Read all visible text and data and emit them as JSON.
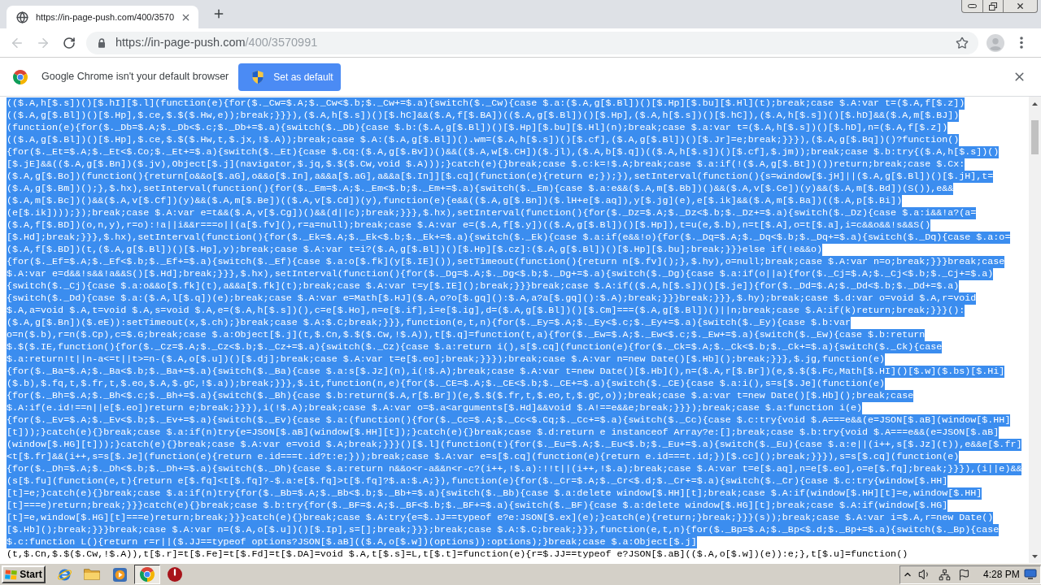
{
  "tabs": [
    {
      "title": "https://in-page-push.com/400/3570",
      "selected": true
    }
  ],
  "toolbar": {
    "back": {
      "disabled": true
    },
    "forward": {
      "disabled": true
    },
    "url": {
      "origin": "https://in-page-push.com",
      "path": "/400/3570991"
    }
  },
  "infobar": {
    "message": "Google Chrome isn't your default browser",
    "button": "Set as default"
  },
  "document": {
    "lines": [
      {
        "text": "(($.A,h[$.s])()[$.hI][$.l](function(e){for($._Cw=$.A;$._Cw<$.b;$._Cw+=$.a){switch($._Cw){case $.a:($.A,g[$.Bl])()[$.Hp][$.bu][$.Hl](t);break;case $.A:var t=($.A,f[$.z])",
        "selected": true
      },
      {
        "text": "(($.A,g[$.Bl])()[$.Hp],$.ce,$.$($.Hw,e));break;}}}),($.A,h[$.s])()[$.hC]&&($.A,f[$.BA])(($.A,g[$.Bl])()[$.Hp],($.A,h[$.s])()[$.hC]),($.A,h[$.s])()[$.hD]&&($.A,m[$.BJ])",
        "selected": true
      },
      {
        "text": "(function(e){for($._Db=$.A;$._Db<$.c;$._Db+=$.a){switch($._Db){case $.b:($.A,g[$.Bl])()[$.Hp][$.bu][$.Hl](n);break;case $.a:var t=($.A,h[$.s])()[$.hD],n=($.A,f[$.z])",
        "selected": true
      },
      {
        "text": "(($.A,g[$.Bl])()[$.Hp],$.ce,$.$($.Hw,t,$.jx,!$.A));break;case $.A:($.A,g[$.Bl])().wm=($.A,h[$.s])()[$.cf],($.A,g[$.Bl])()[$.Jr]=e;break;}}}),($.A,g[$.Bq])()?function()",
        "selected": true
      },
      {
        "text": "{for($._Et=$.A;$._Et<$.Co;$._Et+=$.a){switch($._Et){case $.Cq:($.A,g[$.Bv])()&&(($.A,w[$.CH])($.jl),($.A,b[$.q])(($.A,h[$.s])()[$.cf],$.jm));break;case $.b:try{($.A,h[$.s])()",
        "selected": true
      },
      {
        "text": "[$.jE]&&(($.A,g[$.Bn])($.jv),Object[$.j](navigator,$.jq,$.$($.Cw,void $.A)));}catch(e){}break;case $.c:k=!$.A;break;case $.a:if(!($.A,g[$.Bt])())return;break;case $.Cx:",
        "selected": true
      },
      {
        "text": "($.A,g[$.Bo])(function(){return[o&&o[$.aG],o&&o[$.In],a&&a[$.aG],a&&a[$.In]][$.cq](function(e){return e;});}),setInterval(function(){s=window[$.jH]||($.A,g[$.Bl])()[$.jH],t=",
        "selected": true
      },
      {
        "text": "($.A,g[$.Bm])();},$.hx),setInterval(function(){for($._Em=$.A;$._Em<$.b;$._Em+=$.a){switch($._Em){case $.a:e&&($.A,m[$.Bb])()&&($.A,v[$.Ce])(y)&&($.A,m[$.Bd])(S()),e&&",
        "selected": true
      },
      {
        "text": "($.A,m[$.Bc])()&&($.A,v[$.Cf])(y)&&($.A,m[$.Be])(($.A,v[$.Cd])(y),function(e){e&&(($.A,g[$.Bn])($.lH+e[$.aq]),y[$.jg](e),e[$.ik]&&($.A,m[$.Ba])(($.A,p[$.Bi])",
        "selected": true
      },
      {
        "text": "(e[$.ik])));});break;case $.A:var e=t&&($.A,v[$.Cg])()&&(d||c);break;}}},$.hx),setInterval(function(){for($._Dz=$.A;$._Dz<$.b;$._Dz+=$.a){switch($._Dz){case $.a:i&&!a?(a=",
        "selected": true
      },
      {
        "text": "($.A,f[$.BD])(o,n,y),r=o):!a||i&&r===o||(a[$.fv](),r=a=null);break;case $.A:var e=($.A,f[$.y])(($.A,g[$.Bl])()[$.Hp]),t=u(e,$.b),n=t[$.A],o=t[$.a],i=c&&o&&!s&&S()",
        "selected": true
      },
      {
        "text": "[$.Hd];break;}}},$.hx),setInterval(function(){for($._Ek=$.A;$._Ek<$.b;$._Ek+=$.a){switch($._Ek){case $.a:if(e&&!o){for($._Dq=$.A;$._Dq<$.b;$._Dq+=$.a){switch($._Dq){case $.a:o=",
        "selected": true
      },
      {
        "text": "($.A,f[$.BD])(t,($.A,g[$.Bl])()[$.Hp],y);break;case $.A:var t=i?($.A,g[$.Bl])()[$.Hp][$.cz]:($.A,g[$.Bl])()[$.Hp][$.bu];break;}}}else if(!e&&o)",
        "selected": true
      },
      {
        "text": "{for($._Ef=$.A;$._Ef<$.b;$._Ef+=$.a){switch($._Ef){case $.a:o[$.fk](y[$.IE]()),setTimeout(function(){return n[$.fv]();},$.hy),o=null;break;case $.A:var n=o;break;}}}break;case",
        "selected": true
      },
      {
        "text": "$.A:var e=d&&!s&&!a&&S()[$.Hd];break;}}},$.hx),setInterval(function(){for($._Dg=$.A;$._Dg<$.b;$._Dg+=$.a){switch($._Dg){case $.a:if(o||a){for($._Cj=$.A;$._Cj<$.b;$._Cj+=$.a)",
        "selected": true
      },
      {
        "text": "{switch($._Cj){case $.a:o&&o[$.fk](t),a&&a[$.fk](t);break;case $.A:var t=y[$.IE]();break;}}}break;case $.A:if(($.A,h[$.s])()[$.je]){for($._Dd=$.A;$._Dd<$.b;$._Dd+=$.a)",
        "selected": true
      },
      {
        "text": "{switch($._Dd){case $.a:($.A,l[$.q])(e);break;case $.A:var e=Math[$.HJ]($.A,o?o[$.gq]():$.A,a?a[$.gq]():$.A);break;}}}break;}}},$.hy);break;case $.d:var o=void $.A,r=void",
        "selected": true
      },
      {
        "text": "$.A,a=void $.A,t=void $.A,s=void $.A,e=($.A,h[$.s])(),c=e[$.Ho],n=e[$.if],i=e[$.ig],d=($.A,g[$.Bl])()[$.Cm]===($.A,g[$.Bl])()||n;break;case $.A:if(k)return;break;}}}():",
        "selected": true
      },
      {
        "text": "($.A,g[$.Bn])($.eE)):setTimeout(x,$.ch);}break;case $.A:$.C;break;}}},function(e,t,n){for($._Ey=$.A;$._Ey<$.c;$._Ey+=$.a){switch($._Ey){case $.b:var",
        "selected": true
      },
      {
        "text": "o=n($.b),r=n($.Cp),c=$.G;break;case $.a:Object[$.j](t,$.Cn,$.$($.Cw,!$.A)),t[$.q]=function(t,a){for($._Ew=$.A;$._Ew<$.c;$._Ew+=$.a){switch($._Ew){case $.b:return",
        "selected": true
      },
      {
        "text": "$.$($.IE,function(){for($._Cz=$.A;$._Cz<$.b;$._Cz+=$.a){switch($._Cz){case $.a:return i(),s[$.cq](function(e){for($._Ck=$.A;$._Ck<$.b;$._Ck+=$.a){switch($._Ck){case",
        "selected": true
      },
      {
        "text": "$.a:return!t||n-a<=t||t>=n-($.A,o[$.u])()[$.dj];break;case $.A:var t=e[$.eo];break;}}});break;case $.A:var n=new Date()[$.Hb]();break;}}},$.jg,function(e)",
        "selected": true
      },
      {
        "text": "{for($._Ba=$.A;$._Ba<$.b;$._Ba+=$.a){switch($._Ba){case $.a:s[$.Jz](n),i(!$.A);break;case $.A:var t=new Date()[$.Hb](),n=($.A,r[$.Br])(e,$.$($.Fc,Math[$.HI]()[$.w]($.bs)[$.Hi]",
        "selected": true
      },
      {
        "text": "($.b),$.fq,t,$.fr,t,$.eo,$.A,$.gC,!$.a));break;}}},$.it,function(n,e){for($._CE=$.A;$._CE<$.b;$._CE+=$.a){switch($._CE){case $.a:i(),s=s[$.Je](function(e)",
        "selected": true
      },
      {
        "text": "{for($._Bh=$.A;$._Bh<$.c;$._Bh+=$.a){switch($._Bh){case $.b:return($.A,r[$.Br])(e,$.$($.fr,t,$.eo,t,$.gC,o));break;case $.a:var t=new Date()[$.Hb]();break;case",
        "selected": true
      },
      {
        "text": "$.A:if(e.id!==n||e[$.eo])return e;break;}}}),i(!$.A);break;case $.A:var o=$.a<arguments[$.Hd]&&void $.A!==e&&e;break;}}});break;case $.a:function i(e)",
        "selected": true
      },
      {
        "text": "{for($._Ev=$.A;$._Ev<$.b;$._Ev+=$.a){switch($._Ev){case $.a:(function(){for($._Cc=$.A;$._Cc<$.Cq;$._Cc+=$.a){switch($._Cc){case $.c:try{void $.A===e&&(e=JSON[$.aB](window[$.HH]",
        "selected": true
      },
      {
        "text": "[t]));}catch(e){}break;case $.a:if(n)try{e=JSON[$.aB](window[$.HH][t]);}catch(e){}break;case $.d:return e instanceof Array?e:[];break;case $.b:try{void $.A===e&&(e=JSON[$.aB]",
        "selected": true
      },
      {
        "text": "(window[$.HG][t]));}catch(e){}break;case $.A:var e=void $.A;break;}}}()[$.l](function(t){for($._Eu=$.A;$._Eu<$.b;$._Eu+=$.a){switch($._Eu){case $.a:e||(i++,s[$.Jz](t)),e&&e[$.fr]",
        "selected": true
      },
      {
        "text": "<t[$.fr]&&(i++,s=s[$.Je](function(e){return e.id===t.id?t:e;}));break;case $.A:var e=s[$.cq](function(e){return e.id===t.id;})[$.cc]();break;}}}),s=s[$.cq](function(e)",
        "selected": true
      },
      {
        "text": "{for($._Dh=$.A;$._Dh<$.b;$._Dh+=$.a){switch($._Dh){case $.a:return n&&o<r-a&&n<r-c?(i++,!$.a):!!t||(i++,!$.a);break;case $.A:var t=e[$.aq],n=e[$.eo],o=e[$.fq];break;}}}),(i||e)&&",
        "selected": true
      },
      {
        "text": "(s[$.fu](function(e,t){return e[$.fq]<t[$.fq]?-$.a:e[$.fq]>t[$.fq]?$.a:$.A;}),function(e){for($._Cr=$.A;$._Cr<$.d;$._Cr+=$.a){switch($._Cr){case $.c:try{window[$.HH]",
        "selected": true
      },
      {
        "text": "[t]=e;}catch(e){}break;case $.a:if(n)try{for($._Bb=$.A;$._Bb<$.b;$._Bb+=$.a){switch($._Bb){case $.a:delete window[$.HH][t];break;case $.A:if(window[$.HH][t]=e,window[$.HH]",
        "selected": true
      },
      {
        "text": "[t]===e)return;break;}}}catch(e){}break;case $.b:try{for($._BF=$.A;$._BF<$.b;$._BF+=$.a){switch($._BF){case $.a:delete window[$.HG][t];break;case $.A:if(window[$.HG]",
        "selected": true
      },
      {
        "text": "[t]=e,window[$.HG][t]===e)return;break;}}}catch(e){}break;case $.A:try{e=$.JJ==typeof e?e:JSON[$.ex](e);}catch(e){return;}break;}}}(s));break;case $.A:var i=$.A,r=new Date()",
        "selected": true
      },
      {
        "text": "[$.Hb]();break;}}}break;case $.A:var n=($.A,o[$.u])()[$.Ip],s=[];break;}}};break;case $.A:$.C;break;}}},function(e,t,n){for($._Bp=$.A;$._Bp<$.d;$._Bp+=$.a){switch($._Bp){case",
        "selected": true
      },
      {
        "text": "$.c:function L(){return r=r||($.JJ==typeof options?JSON[$.aB](($.A,o[$.w])(options)):options);}break;case $.a:Object[$.j]",
        "selected": true
      },
      {
        "text": "(t,$.Cn,$.$($.Cw,!$.A)),t[$.r]=t[$.Fe]=t[$.Fd]=t[$.DA]=void $.A,t[$.s]=L,t[$.t]=function(e){r=$.JJ==typeof e?JSON[$.aB](($.A,o[$.w])(e)):e;},t[$.u]=function()",
        "selected": false
      }
    ]
  },
  "taskbar": {
    "start": "Start",
    "apps": [
      {
        "kind": "ie",
        "selected": false
      },
      {
        "kind": "folder",
        "selected": false
      },
      {
        "kind": "media",
        "selected": false
      },
      {
        "kind": "chrome",
        "selected": true
      },
      {
        "kind": "alert",
        "selected": false
      }
    ],
    "clock": "4:28 PM"
  }
}
